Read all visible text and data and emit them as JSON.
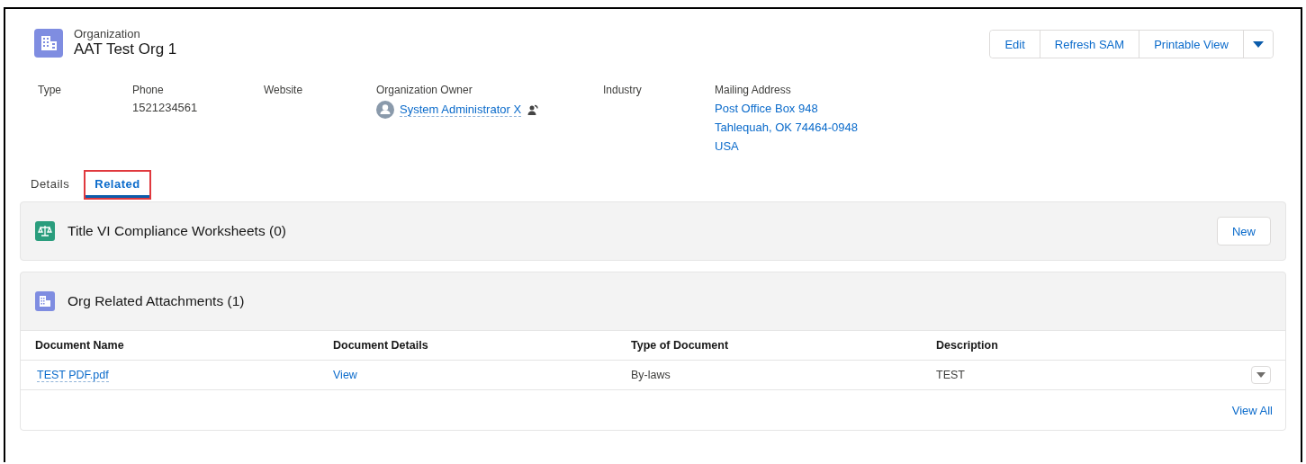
{
  "header": {
    "object_type": "Organization",
    "title": "AAT Test Org 1",
    "actions": [
      "Edit",
      "Refresh SAM",
      "Printable View"
    ]
  },
  "fields": [
    {
      "label": "Type",
      "kind": "text"
    },
    {
      "label": "Phone",
      "kind": "text",
      "lines": [
        "1521234561"
      ]
    },
    {
      "label": "Website",
      "kind": "text"
    },
    {
      "label": "Organization Owner",
      "kind": "user",
      "lines": [
        "System Administrator X"
      ]
    },
    {
      "label": "Industry",
      "kind": "text"
    },
    {
      "label": "Mailing Address",
      "kind": "address",
      "lines": [
        "Post Office Box 948",
        "Tahlequah, OK 74464-0948",
        "USA"
      ]
    }
  ],
  "tabs": [
    {
      "label": "Details",
      "selected": false,
      "highlighted": false
    },
    {
      "label": "Related",
      "selected": true,
      "highlighted": true
    }
  ],
  "related_lists": [
    {
      "kind": "worksheets",
      "title": "Title VI Compliance Worksheets (0)",
      "button": "New"
    },
    {
      "kind": "attachments",
      "title": "Org Related Attachments (1)",
      "columns": [
        "Document Name",
        "Document Details",
        "Type of Document",
        "Description"
      ],
      "rows": [
        [
          "TEST PDF.pdf",
          "View",
          "By-laws",
          "TEST"
        ]
      ],
      "footer_link": "View All"
    }
  ]
}
